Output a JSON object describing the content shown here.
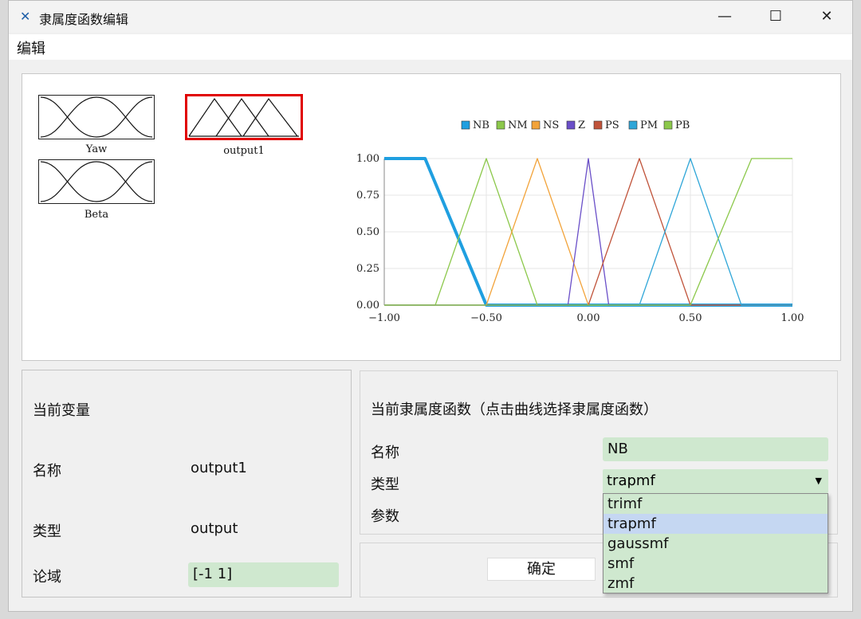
{
  "window": {
    "title": "隶属度函数编辑",
    "minimize": "—",
    "maximize": "☐",
    "close": "✕"
  },
  "menu": {
    "edit": "编辑"
  },
  "variables": [
    {
      "label": "Yaw",
      "selected": false
    },
    {
      "label": "output1",
      "selected": true
    },
    {
      "label": "Beta",
      "selected": false
    }
  ],
  "chart_data": {
    "type": "line",
    "xlim": [
      -1,
      1
    ],
    "ylim": [
      0,
      1
    ],
    "x_ticks": [
      "−1.00",
      "−0.50",
      "0.00",
      "0.50",
      "1.00"
    ],
    "y_ticks": [
      "0.00",
      "0.25",
      "0.50",
      "0.75",
      "1.00"
    ],
    "legend_position": "top",
    "grid": true,
    "series": [
      {
        "name": "NB",
        "color": "#1f9fe0",
        "x": [
          -1,
          -0.8,
          -0.5,
          1
        ],
        "y": [
          1,
          1,
          0,
          0
        ],
        "bold": true
      },
      {
        "name": "NM",
        "color": "#8cc84b",
        "x": [
          -1,
          -0.75,
          -0.5,
          -0.25,
          1
        ],
        "y": [
          0,
          0,
          1,
          0,
          0
        ]
      },
      {
        "name": "NS",
        "color": "#f2a33a",
        "x": [
          -1,
          -0.5,
          -0.25,
          0,
          1
        ],
        "y": [
          0,
          0,
          1,
          0,
          0
        ]
      },
      {
        "name": "Z",
        "color": "#6a4fc8",
        "x": [
          -1,
          -0.1,
          0,
          0.1,
          1
        ],
        "y": [
          0,
          0,
          1,
          0,
          0
        ]
      },
      {
        "name": "PS",
        "color": "#c0533a",
        "x": [
          -1,
          0,
          0.25,
          0.5,
          1
        ],
        "y": [
          0,
          0,
          1,
          0,
          0
        ]
      },
      {
        "name": "PM",
        "color": "#2fa6d8",
        "x": [
          -1,
          0.25,
          0.5,
          0.75,
          1
        ],
        "y": [
          0,
          0,
          1,
          0,
          0
        ]
      },
      {
        "name": "PB",
        "color": "#8cc84b",
        "x": [
          -1,
          0.5,
          0.8,
          1
        ],
        "y": [
          0,
          0,
          1,
          1
        ]
      }
    ]
  },
  "current_var": {
    "heading": "当前变量",
    "name_label": "名称",
    "name_value": "output1",
    "type_label": "类型",
    "type_value": "output",
    "range_label": "论域",
    "range_value": "[-1 1]"
  },
  "current_mf": {
    "heading": "当前隶属度函数（点击曲线选择隶属度函数）",
    "name_label": "名称",
    "name_value": "NB",
    "type_label": "类型",
    "type_value": "trapmf",
    "params_label": "参数",
    "type_options": [
      "trimf",
      "trapmf",
      "gaussmf",
      "smf",
      "zmf"
    ],
    "highlighted_option": "trapmf"
  },
  "ok_button": "确定"
}
